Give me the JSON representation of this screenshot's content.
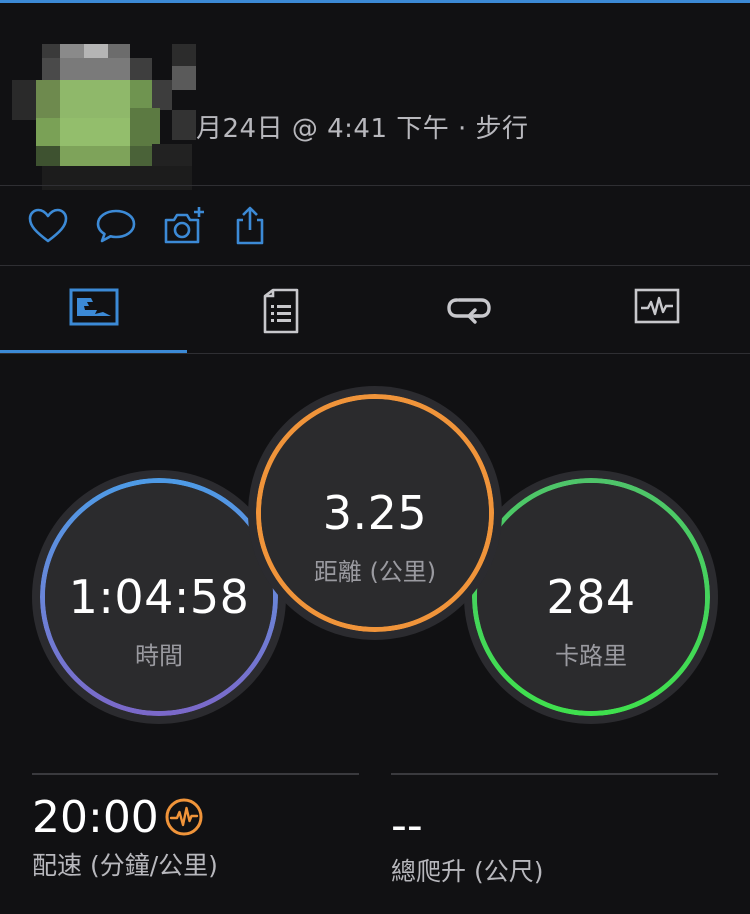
{
  "header": {
    "date_text": "月24日 @ 4:41 下午 · 步行"
  },
  "actions": {
    "like_icon": "heart-icon",
    "comment_icon": "comment-icon",
    "photo_icon": "camera-add-icon",
    "share_icon": "share-icon"
  },
  "tabs": [
    {
      "icon": "stats-overview-icon",
      "active": true
    },
    {
      "icon": "details-list-icon",
      "active": false
    },
    {
      "icon": "laps-icon",
      "active": false
    },
    {
      "icon": "chart-icon",
      "active": false
    }
  ],
  "metrics": {
    "time": {
      "value": "1:04:58",
      "label": "時間"
    },
    "distance": {
      "value": "3.25",
      "label": "距離 (公里)"
    },
    "calories": {
      "value": "284",
      "label": "卡路里"
    }
  },
  "stats": {
    "pace": {
      "value": "20:00",
      "label": "配速 (分鐘/公里)",
      "icon": "heart-rate-icon"
    },
    "ascent": {
      "value": "--",
      "label": "總爬升 (公尺)"
    }
  },
  "colors": {
    "accent_blue": "#3c8ad6",
    "time_ring": [
      "#4d9be6",
      "#7b68c9"
    ],
    "distance_ring": "#f0943a",
    "calories_ring": [
      "#4fc46a",
      "#3fe04d"
    ],
    "pace_icon": "#f0943a"
  }
}
